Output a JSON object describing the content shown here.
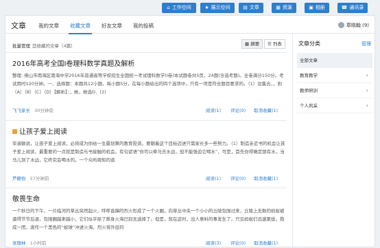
{
  "topnav": {
    "buttons": [
      {
        "label": "工作空间",
        "icon": "home-icon"
      },
      {
        "label": "展示空间",
        "icon": "star-icon"
      },
      {
        "label": "文章",
        "icon": "document-icon"
      },
      {
        "label": "资源",
        "icon": "folder-icon"
      },
      {
        "label": "相册",
        "icon": "photo-icon"
      },
      {
        "label": "通讯录",
        "icon": "contacts-icon"
      }
    ]
  },
  "header": {
    "title": "文章",
    "tabs": [
      "我的文章",
      "收藏文章",
      "好友文章",
      "我的投稿"
    ],
    "user": "章晓翰 (9)"
  },
  "toolbar": {
    "batch": "批量管理",
    "count": "您收藏的文章（4篇）",
    "view_summary": "摘要",
    "view_list": "列表"
  },
  "articles": [
    {
      "title": "2016年高考全国I卷理科数学真题及解析",
      "locked": false,
      "summary": "整理: 佛山市南海区南海中学2016年普通高等学校招生全国统一考试理科数学(I卷)本试题卷共5页，24题(含选考题)。全卷满分150分。考试用时120分钟。一、选择题：本题共12小题，每小题5分，在每小题给出的四个选项中，只有一项是符合题目要求的。（1）设集合，，则（A）（B）（C）（D）【解析】：，故，故选D．(2)",
      "author": "飞飞家长",
      "time": "30分钟前",
      "reads": "阅读(1)",
      "comments": "评论(0)",
      "unfav": "取消收藏(1)"
    },
    {
      "title": "让孩子爱上阅读",
      "locked": true,
      "summary": "毕淑敏说，让孩子爱上阅读，必将成为你给一生最划算的教育投资。要朝着这个目标迈进只需家长多一些努力。（1）制造亲近书的机会让孩子爱上阅读，最重要的一点就是制造与书接触的机会。有句谚语“你可以牵马去水边，但不能强迫它喝水”，可是，首先你得确定那有水，当马儿到了水边，它终究会喝水的。一个众所周知的道",
      "author": "芦静怡",
      "time": "57分钟前",
      "reads": "阅读(1)",
      "comments": "评论(0)",
      "unfav": "取消收藏(1)"
    },
    {
      "title": "敬畏生命",
      "locked": false,
      "summary": "一个秋日的下午，一片临河的草丛突然起火，呼呼直蹿的烈火形成了一个火圈，向草丛中央一个小小的丘陵包围过来，丘陵上无数的蚂蚁被逼得节节后退，包围圈越来越小，它们似乎除了葬身火海已别无选择了。但是，就在这时，出人意料的事发生了，只见蚂蚁们迅速聚拢，抱成一团，滚作一个黑色的“蚁球”冲进火海，烈火将外层的",
      "author": "张丽林",
      "time": "1小时前",
      "reads": "阅读(3)",
      "comments": "评论(0)",
      "unfav": "取消收藏(1)"
    }
  ],
  "sidebar": {
    "title": "文章分类",
    "manage": "管理",
    "categories": [
      {
        "label": "全部文章",
        "selected": true
      },
      {
        "label": "教育教学",
        "selected": false
      },
      {
        "label": "教师研训",
        "selected": false
      },
      {
        "label": "个人风采",
        "selected": false
      }
    ]
  },
  "colors": {
    "accent": "#2f7ecb",
    "lock": "#e8a33b"
  }
}
